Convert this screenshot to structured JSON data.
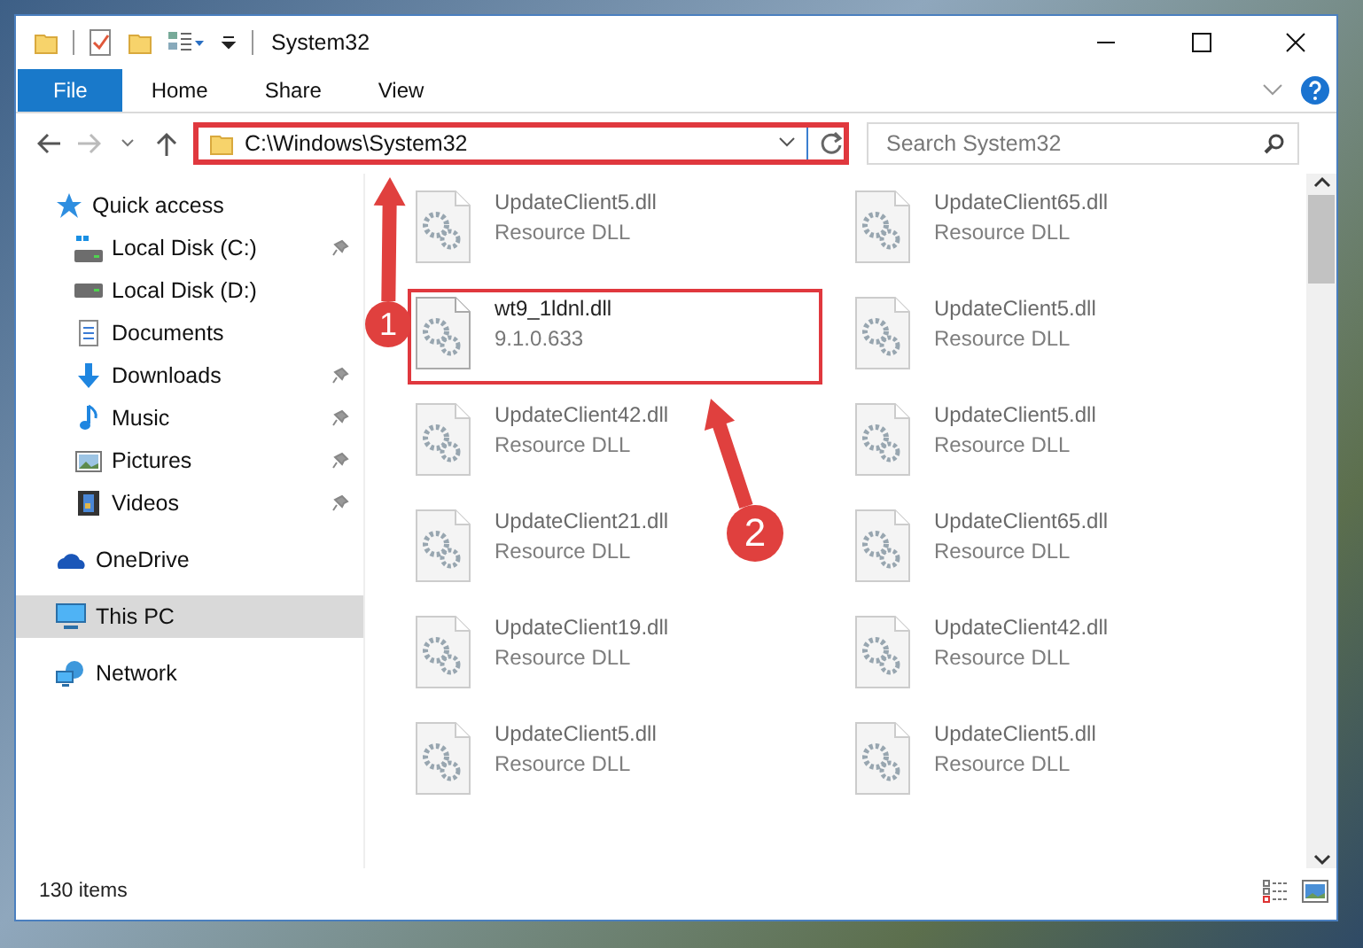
{
  "window": {
    "title": "System32"
  },
  "ribbon": {
    "tabs": [
      {
        "label": "File",
        "kind": "file"
      },
      {
        "label": "Home",
        "kind": "tab"
      },
      {
        "label": "Share",
        "kind": "tab"
      },
      {
        "label": "View",
        "kind": "tab"
      }
    ]
  },
  "address_bar": {
    "path": "C:\\Windows\\System32",
    "highlighted": true
  },
  "search": {
    "placeholder": "Search System32"
  },
  "sidebar": {
    "items": [
      {
        "label": "Quick access",
        "selected": false,
        "children": [
          {
            "label": "Local Disk (C:)",
            "selected": false,
            "pinned": true
          },
          {
            "label": "Local Disk (D:)",
            "selected": false,
            "pinned": false
          },
          {
            "label": "Documents",
            "selected": false,
            "pinned": false
          },
          {
            "label": "Downloads",
            "selected": false,
            "pinned": true
          },
          {
            "label": "Music",
            "selected": false,
            "pinned": true
          },
          {
            "label": "Pictures",
            "selected": false,
            "pinned": true
          },
          {
            "label": "Videos",
            "selected": false,
            "pinned": true
          }
        ]
      },
      {
        "label": "OneDrive",
        "selected": false
      },
      {
        "label": "This PC",
        "selected": true
      },
      {
        "label": "Network",
        "selected": false
      }
    ]
  },
  "files": [
    {
      "name": "UpdateClient5.dll",
      "detail": "Resource DLL",
      "blurred": true,
      "highlighted": false
    },
    {
      "name": "UpdateClient65.dll",
      "detail": "Resource DLL",
      "blurred": true,
      "highlighted": false
    },
    {
      "name": "wt9_1ldnl.dll",
      "detail": "9.1.0.633",
      "blurred": false,
      "highlighted": true
    },
    {
      "name": "UpdateClient5.dll",
      "detail": "Resource DLL",
      "blurred": true,
      "highlighted": false
    },
    {
      "name": "UpdateClient42.dll",
      "detail": "Resource DLL",
      "blurred": true,
      "highlighted": false
    },
    {
      "name": "UpdateClient5.dll",
      "detail": "Resource DLL",
      "blurred": true,
      "highlighted": false
    },
    {
      "name": "UpdateClient21.dll",
      "detail": "Resource DLL",
      "blurred": true,
      "highlighted": false
    },
    {
      "name": "UpdateClient65.dll",
      "detail": "Resource DLL",
      "blurred": true,
      "highlighted": false
    },
    {
      "name": "UpdateClient19.dll",
      "detail": "Resource DLL",
      "blurred": true,
      "highlighted": false
    },
    {
      "name": "UpdateClient42.dll",
      "detail": "Resource DLL",
      "blurred": true,
      "highlighted": false
    },
    {
      "name": "UpdateClient5.dll",
      "detail": "Resource DLL",
      "blurred": true,
      "highlighted": false
    },
    {
      "name": "UpdateClient5.dll",
      "detail": "Resource DLL",
      "blurred": true,
      "highlighted": false
    }
  ],
  "status_bar": {
    "item_count": "130 items"
  },
  "annotations": [
    {
      "label": "1"
    },
    {
      "label": "2"
    }
  ]
}
